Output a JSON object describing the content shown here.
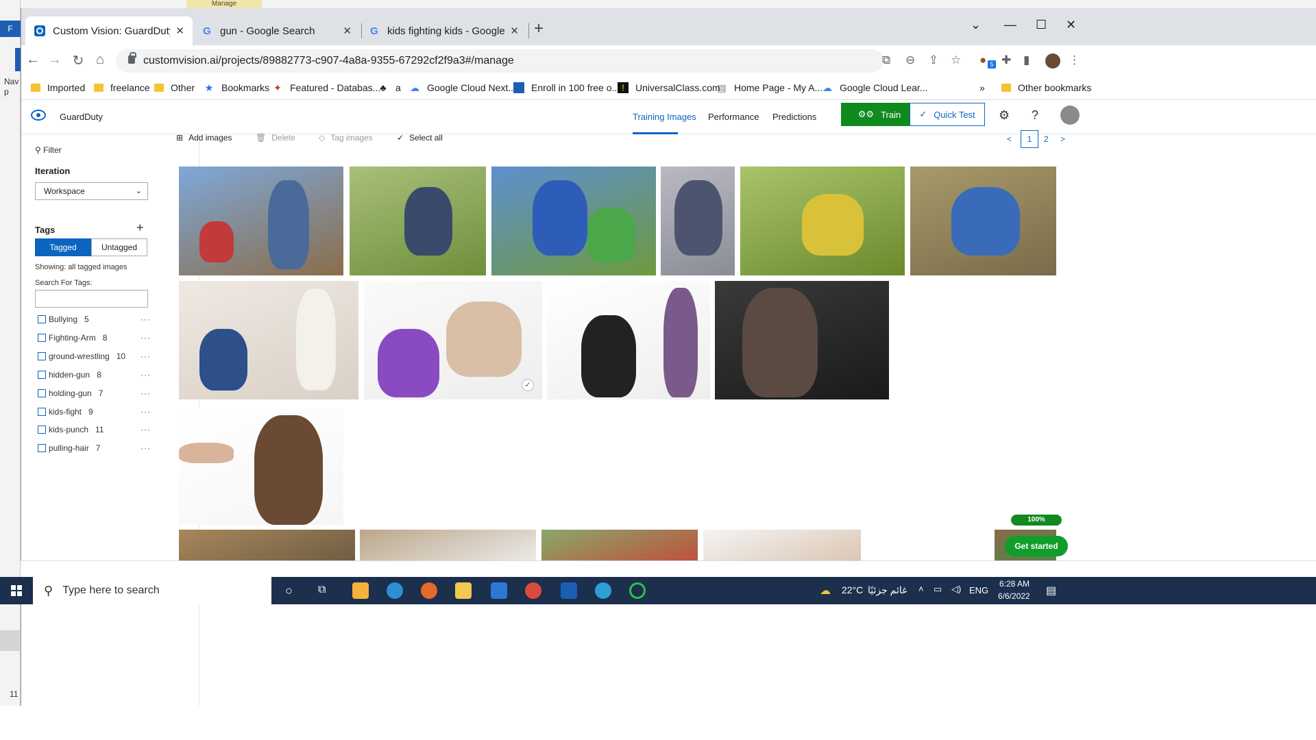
{
  "desktop": {
    "left_label": "Nav\np",
    "left_blue_label": "F",
    "left_number": "11",
    "top_tab_label": "Manage"
  },
  "browser": {
    "tabs": [
      {
        "title": "Custom Vision: GuardDuty - Train",
        "favicon": "custom-vision-icon",
        "active": true
      },
      {
        "title": "gun - Google Search",
        "favicon": "google-icon",
        "active": false
      },
      {
        "title": "kids fighting kids - Google Search",
        "favicon": "google-icon",
        "active": false
      }
    ],
    "url": "customvision.ai/projects/89882773-c907-4a8a-9355-67292cf2f9a3#/manage",
    "extension_badge": "5",
    "bookmarks": [
      {
        "label": "Imported",
        "icon": "folder-icon"
      },
      {
        "label": "freelance",
        "icon": "folder-icon"
      },
      {
        "label": "Other",
        "icon": "folder-icon"
      },
      {
        "label": "Bookmarks",
        "icon": "star-icon"
      },
      {
        "label": "Featured - Databas...",
        "icon": "bookmark-icon"
      },
      {
        "label": "a",
        "icon": "bookmark-icon"
      },
      {
        "label": "Google Cloud Next...",
        "icon": "google-cloud-icon"
      },
      {
        "label": "Enroll in 100 free o...",
        "icon": "bookmark-icon"
      },
      {
        "label": "UniversalClass.com",
        "icon": "bookmark-icon"
      },
      {
        "label": "Home Page - My A...",
        "icon": "bookmark-icon"
      },
      {
        "label": "Google Cloud Lear...",
        "icon": "google-cloud-icon"
      }
    ],
    "bookmarks_overflow": "»",
    "other_bookmarks": "Other bookmarks"
  },
  "app": {
    "project_name": "GuardDuty",
    "nav": {
      "training_images": "Training Images",
      "performance": "Performance",
      "predictions": "Predictions"
    },
    "train_label": "Train",
    "quick_test_label": "Quick Test",
    "accent_color": "#0b64c0",
    "train_color": "#0f8a1f"
  },
  "sidebar": {
    "filter_label": "Filter",
    "iteration_heading": "Iteration",
    "iteration_value": "Workspace",
    "tags_heading": "Tags",
    "tagged_label": "Tagged",
    "untagged_label": "Untagged",
    "showing_text": "Showing: all tagged images",
    "search_label": "Search For Tags:",
    "search_value": "",
    "tags": [
      {
        "name": "Bullying",
        "count": "5"
      },
      {
        "name": "Fighting-Arm",
        "count": "8"
      },
      {
        "name": "ground-wrestling",
        "count": "10"
      },
      {
        "name": "hidden-gun",
        "count": "8"
      },
      {
        "name": "holding-gun",
        "count": "7"
      },
      {
        "name": "kids-fight",
        "count": "9"
      },
      {
        "name": "kids-punch",
        "count": "11"
      },
      {
        "name": "pulling-hair",
        "count": "7"
      }
    ],
    "more_label": "···"
  },
  "commands": {
    "add_images": "Add images",
    "delete": "Delete",
    "tag_images": "Tag images",
    "select_all": "Select all"
  },
  "pagination": {
    "prev": "<",
    "pages": [
      "1",
      "2"
    ],
    "next": ">"
  },
  "progress_badge": "100%",
  "get_started_label": "Get started",
  "taskbar": {
    "search_placeholder": "Type here to search",
    "weather": "22°C",
    "weather_desc": "غائم جزئيًا",
    "language": "ENG",
    "time": "6:28 AM",
    "date": "6/6/2022"
  }
}
